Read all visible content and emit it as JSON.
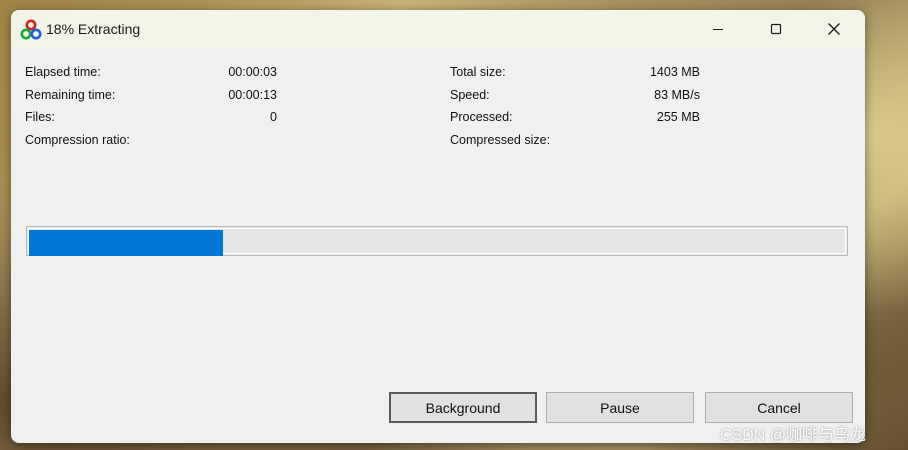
{
  "window": {
    "title": "18% Extracting",
    "app_icon": "7zip-extract-icon"
  },
  "titlebar_buttons": {
    "minimize_icon": "minimize-icon",
    "maximize_icon": "maximize-icon",
    "close_icon": "close-icon"
  },
  "stats_left": [
    {
      "label": "Elapsed time:",
      "value": "00:00:03"
    },
    {
      "label": "Remaining time:",
      "value": "00:00:13"
    },
    {
      "label": "Files:",
      "value": "0"
    },
    {
      "label": "Compression ratio:",
      "value": ""
    }
  ],
  "stats_right": [
    {
      "label": "Total size:",
      "value": "1403 MB"
    },
    {
      "label": "Speed:",
      "value": "83 MB/s"
    },
    {
      "label": "Processed:",
      "value": "255 MB"
    },
    {
      "label": "Compressed size:",
      "value": ""
    }
  ],
  "progress": {
    "fraction": 0.18,
    "color": "#0078d7"
  },
  "buttons": {
    "background": "Background",
    "pause": "Pause",
    "cancel": "Cancel"
  },
  "watermark": "CSDN @咖啡与乌龙"
}
